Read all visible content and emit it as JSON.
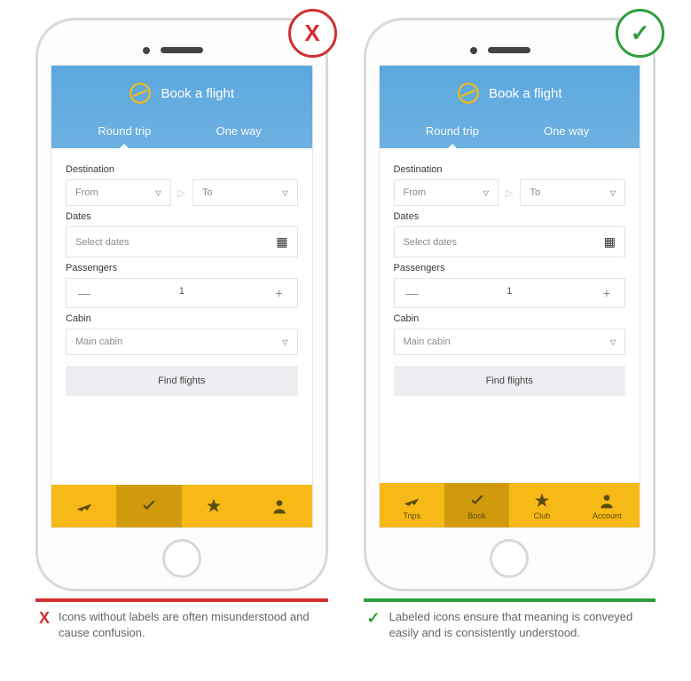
{
  "header": {
    "title": "Book a flight",
    "tabs": [
      "Round trip",
      "One way"
    ]
  },
  "form": {
    "destination_label": "Destination",
    "from_placeholder": "From",
    "to_placeholder": "To",
    "dates_label": "Dates",
    "dates_placeholder": "Select dates",
    "passengers_label": "Passengers",
    "passengers_value": "1",
    "minus": "—",
    "plus": "+",
    "cabin_label": "Cabin",
    "cabin_value": "Main cabin",
    "find": "Find flights"
  },
  "nav": {
    "items": [
      {
        "label": "Trips"
      },
      {
        "label": "Book"
      },
      {
        "label": "Club"
      },
      {
        "label": "Account"
      }
    ]
  },
  "badges": {
    "bad": "X",
    "good": "✓"
  },
  "captions": {
    "bad_mark": "X",
    "bad": "Icons without labels are often misunderstood and cause confusion.",
    "good_mark": "✓",
    "good": "Labeled icons ensure that meaning is conveyed easily and is consistently understood."
  }
}
